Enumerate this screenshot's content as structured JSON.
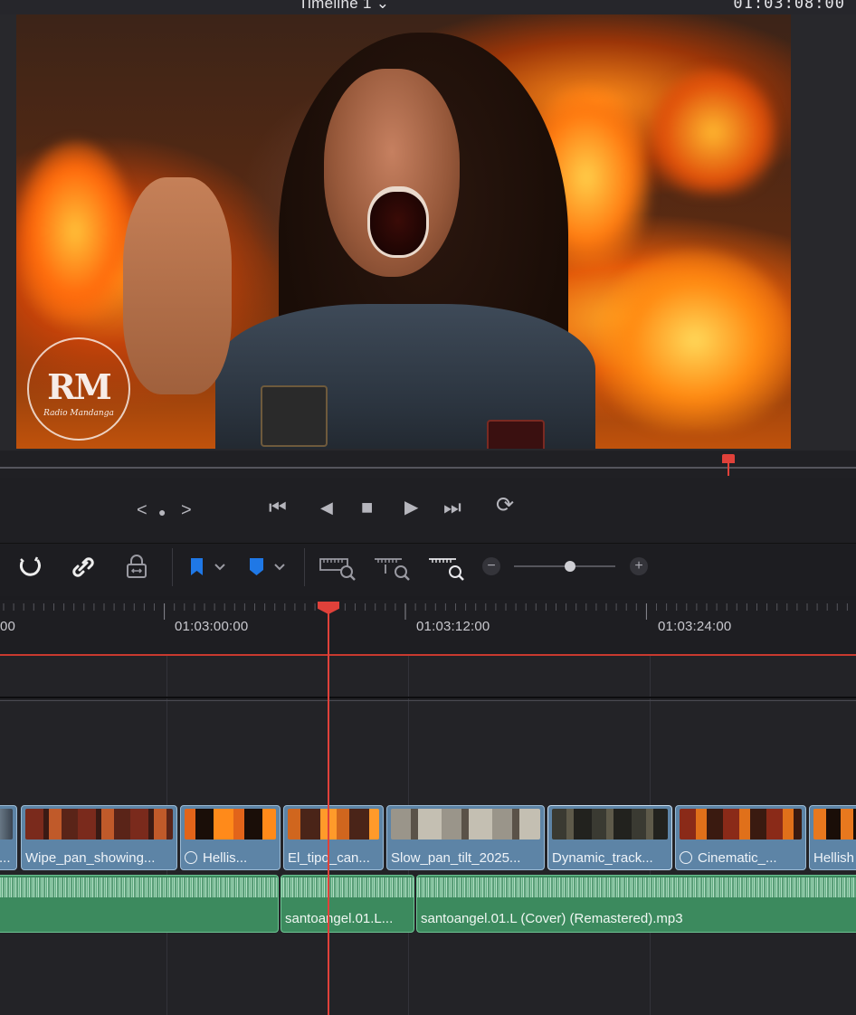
{
  "viewer": {
    "timeline_name": "Timeline 1 ⌄",
    "timecode": "01:03:08:00",
    "watermark": {
      "initials": "RM",
      "name": "Radio Mandanga"
    }
  },
  "transport": {
    "prev": "<",
    "dot": "●",
    "next": ">",
    "first": "⏮",
    "reverse": "◀",
    "stop": "■",
    "play": "▶",
    "last": "⏭",
    "loop": "⟳"
  },
  "toolbar": {
    "zoom_minus": "−",
    "zoom_plus": "+",
    "zoom_level": 0.55
  },
  "ruler": {
    "labels": [
      "00",
      "01:03:00:00",
      "01:03:12:00",
      "01:03:24:00"
    ]
  },
  "video_clips": [
    {
      "label": "..."
    },
    {
      "label": "Wipe_pan_showing..."
    },
    {
      "label": "Hellis...",
      "speed": true
    },
    {
      "label": "El_tipo_can..."
    },
    {
      "label": "Slow_pan_tilt_2025..."
    },
    {
      "label": "Dynamic_track..."
    },
    {
      "label": "Cinematic_...",
      "speed": true
    },
    {
      "label": "Hellish"
    }
  ],
  "audio_clips": [
    {
      "label": ""
    },
    {
      "label": "santoangel.01.L..."
    },
    {
      "label": "santoangel.01.L (Cover) (Remastered).mp3"
    }
  ],
  "colors": {
    "playhead": "#e0413a",
    "video_clip": "#5d84a6",
    "audio_clip": "#3c8a5e",
    "marker_blue": "#1f78e6"
  }
}
